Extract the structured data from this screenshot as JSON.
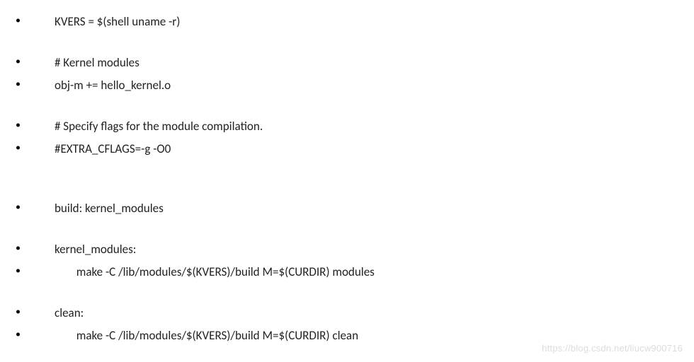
{
  "lines": {
    "l0": "KVERS = $(shell uname -r)",
    "l1": "# Kernel modules",
    "l2": "obj-m += hello_kernel.o",
    "l3": "# Specify flags for the module compilation.",
    "l4": "#EXTRA_CFLAGS=-g -O0",
    "l5": "build: kernel_modules",
    "l6": "kernel_modules:",
    "l7": "        make -C /lib/modules/$(KVERS)/build M=$(CURDIR) modules",
    "l8": "clean:",
    "l9": "        make -C /lib/modules/$(KVERS)/build M=$(CURDIR) clean"
  },
  "bullet_glyph": "•",
  "watermark": "https://blog.csdn.net/liucw900716"
}
